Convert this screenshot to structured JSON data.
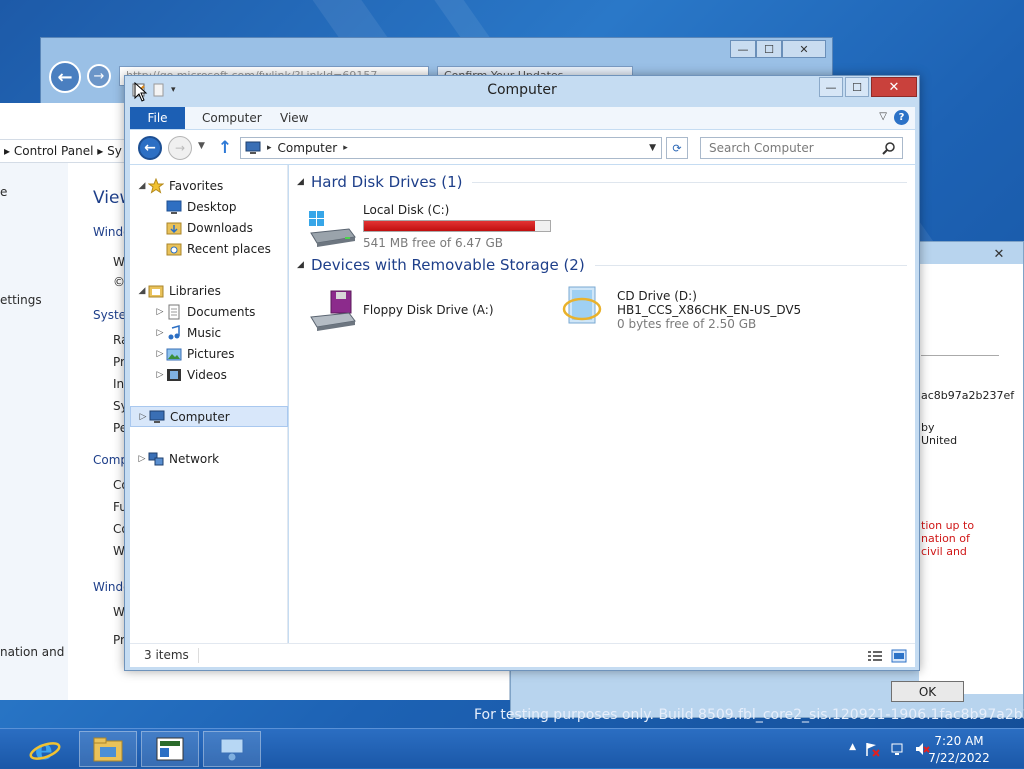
{
  "colors": {
    "accent": "#1c5fb4",
    "drive_bar_full": "#d01818",
    "group_header": "#1e3f8a"
  },
  "background": {
    "ie": {
      "address_text": "http://go.microsoft.com/fwlink/?LinkId=69157",
      "tab_text": "Confirm Your Updates"
    },
    "control_panel": {
      "breadcrumb": "Control Panel",
      "breadcrumb_next": "Sy",
      "view_heading": "View",
      "left_texts": [
        "e",
        "ettings",
        "nation and"
      ],
      "lines": [
        {
          "text": "Windo",
          "kind": "head"
        },
        {
          "text": "W",
          "kind": "item"
        },
        {
          "text": "©",
          "kind": "item"
        },
        {
          "text": "Syster",
          "kind": "head"
        },
        {
          "text": "Ra",
          "kind": "item"
        },
        {
          "text": "Pr",
          "kind": "item"
        },
        {
          "text": "In",
          "kind": "item"
        },
        {
          "text": "Sy",
          "kind": "item"
        },
        {
          "text": "Pe",
          "kind": "item"
        },
        {
          "text": "Comp",
          "kind": "head"
        },
        {
          "text": "Co",
          "kind": "item"
        },
        {
          "text": "Fu",
          "kind": "item"
        },
        {
          "text": "Co",
          "kind": "item"
        },
        {
          "text": "W",
          "kind": "item"
        },
        {
          "text": "Windo",
          "kind": "head"
        },
        {
          "text": "W",
          "kind": "item"
        },
        {
          "text": "Pr",
          "kind": "item"
        }
      ]
    },
    "dialog": {
      "hash_text": "ac8b97a2b237ef",
      "by_text": "by",
      "united_text": "United",
      "warning_lines": [
        "tion up to",
        "nation of",
        "civil and"
      ],
      "ok_label": "OK",
      "close_label": "✕"
    },
    "build_text": "For testing purposes only. Build 8509.fbl_core2_sis.120921-1906.1fac8b97a2b237ef"
  },
  "window": {
    "title": "Computer",
    "buttons": {
      "minimize": "—",
      "maximize": "☐",
      "close": "✕"
    },
    "ribbon_tabs": [
      "File",
      "Computer",
      "View"
    ],
    "help_label": "?",
    "address": {
      "location": "Computer"
    },
    "search": {
      "placeholder": "Search Computer"
    },
    "navigation": [
      {
        "label": "Favorites",
        "icon": "star-icon",
        "level": 0,
        "arrow": "◢"
      },
      {
        "label": "Desktop",
        "icon": "desktop-icon",
        "level": 1,
        "arrow": ""
      },
      {
        "label": "Downloads",
        "icon": "downloads-icon",
        "level": 1,
        "arrow": ""
      },
      {
        "label": "Recent places",
        "icon": "recent-places-icon",
        "level": 1,
        "arrow": ""
      },
      {
        "label": "Libraries",
        "icon": "libraries-icon",
        "level": 0,
        "arrow": "◢"
      },
      {
        "label": "Documents",
        "icon": "documents-icon",
        "level": 1,
        "arrow": "▷"
      },
      {
        "label": "Music",
        "icon": "music-icon",
        "level": 1,
        "arrow": "▷"
      },
      {
        "label": "Pictures",
        "icon": "pictures-icon",
        "level": 1,
        "arrow": "▷"
      },
      {
        "label": "Videos",
        "icon": "videos-icon",
        "level": 1,
        "arrow": "▷"
      },
      {
        "label": "Computer",
        "icon": "computer-icon",
        "level": 0,
        "arrow": "▷",
        "selected": true
      },
      {
        "label": "Network",
        "icon": "network-icon",
        "level": 0,
        "arrow": "▷"
      }
    ],
    "groups": {
      "hard_disk": {
        "title": "Hard Disk Drives (1)"
      },
      "removable": {
        "title": "Devices with Removable Storage (2)"
      }
    },
    "drives": {
      "local_disk": {
        "name": "Local Disk (C:)",
        "free_text": "541 MB free of 6.47 GB",
        "used_fraction": 0.918
      },
      "floppy": {
        "name": "Floppy Disk Drive (A:)"
      },
      "cd": {
        "name": "CD Drive (D:)",
        "volume": "HB1_CCS_X86CHK_EN-US_DV5",
        "free_text": "0 bytes free of 2.50 GB"
      }
    },
    "status": {
      "items_text": "3 items"
    }
  },
  "taskbar": {
    "clock_time": "7:20 AM",
    "clock_date": "7/22/2022",
    "tray_chevron": "▲"
  }
}
